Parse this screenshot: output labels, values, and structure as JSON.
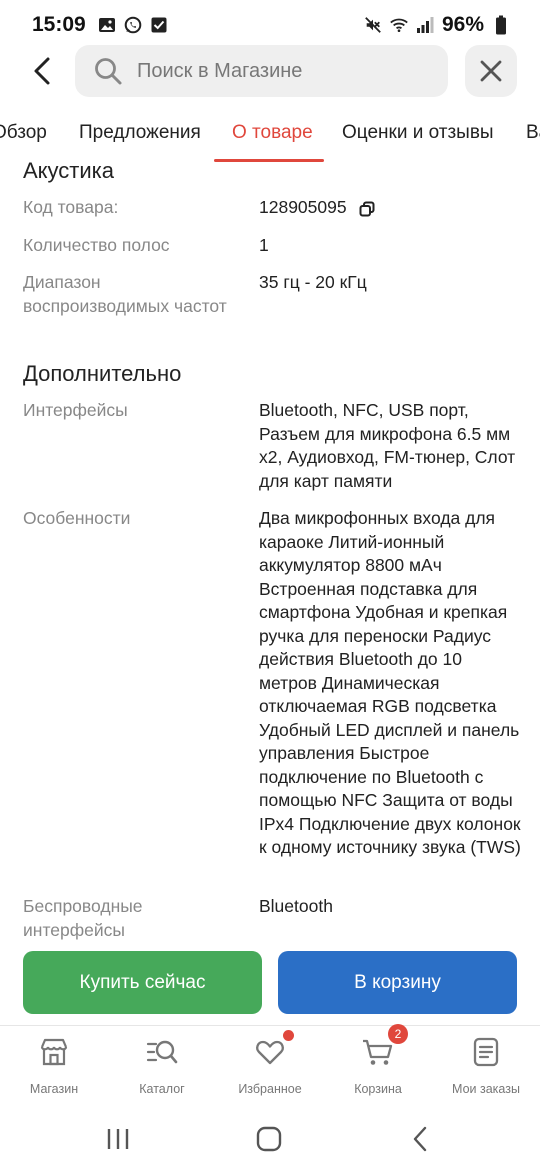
{
  "status_bar": {
    "time": "15:09",
    "battery": "96%",
    "left_icons": [
      "image-icon",
      "whatsapp-icon",
      "checkbox-icon"
    ],
    "right_icons": [
      "mute-icon",
      "wifi-icon",
      "signal-icon",
      "battery-icon"
    ]
  },
  "header": {
    "search_placeholder": "Поиск в Магазине"
  },
  "tabs": [
    {
      "label": "Обзор",
      "active": false
    },
    {
      "label": "Предложения",
      "active": false
    },
    {
      "label": "О товаре",
      "active": true
    },
    {
      "label": "Оценки и отзывы",
      "active": false
    },
    {
      "label": "Ва",
      "active": false
    }
  ],
  "sections": {
    "acoustics": {
      "title": "Акустика",
      "rows": [
        {
          "label": "Код товара:",
          "value": "128905095"
        },
        {
          "label": "Количество полос",
          "value": "1"
        },
        {
          "label": "Диапазон воспроизводимых частот",
          "value": "35 гц - 20 кГц"
        }
      ]
    },
    "additional": {
      "title": "Дополнительно",
      "rows": [
        {
          "label": "Интерфейсы",
          "value": "Bluetooth, NFC, USB порт, Разъем для микрофона 6.5 мм х2, Аудиовход, FM-тюнер, Слот для карт памяти"
        },
        {
          "label": "Особенности",
          "value": "Два микрофонных входа для караоке Литий-ионный аккумулятор 8800 мАч Встроенная подставка для смартфона Удобная и крепкая ручка для переноски Радиус действия Bluetooth до 10 метров Динамическая отключаемая RGB подсветка Удобный LED дисплей и панель управления Быстрое подключение по Bluetooth с помощью NFC Защита от воды IPx4 Подключение двух колонок к одному источнику звука (TWS)"
        },
        {
          "label": "Беспроводные интерфейсы",
          "value": "Bluetooth"
        }
      ]
    }
  },
  "actions": {
    "buy_now": "Купить сейчас",
    "add_to_cart": "В корзину",
    "buy_color": "#46a95a",
    "cart_color": "#2b6fc6"
  },
  "bottom_nav": [
    {
      "label": "Магазин",
      "icon": "store-icon"
    },
    {
      "label": "Каталог",
      "icon": "catalog-search-icon"
    },
    {
      "label": "Избранное",
      "icon": "heart-icon",
      "has_dot": true
    },
    {
      "label": "Корзина",
      "icon": "cart-icon",
      "badge": "2"
    },
    {
      "label": "Мои заказы",
      "icon": "orders-icon"
    }
  ],
  "accent_color": "#e0473c"
}
